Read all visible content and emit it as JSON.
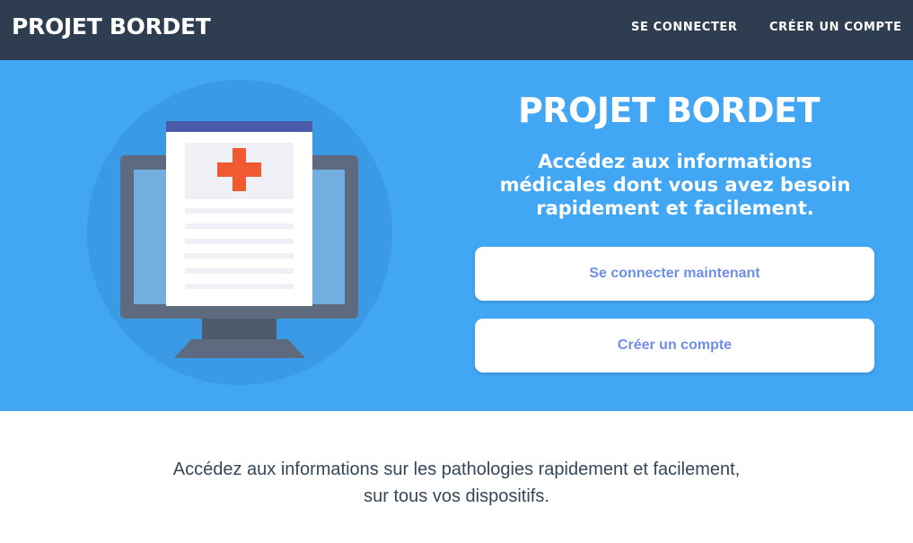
{
  "navbar": {
    "brand": "PROJET BORDET",
    "links": {
      "login": "SE CONNECTER",
      "signup": "CRÉER UN COMPTE"
    }
  },
  "hero": {
    "title": "PROJET BORDET",
    "subtitle_lines": [
      "Accédez aux informations",
      "médicales dont vous avez besoin",
      "rapidement et facilement."
    ],
    "buttons": {
      "login": "Se connecter maintenant",
      "signup": "Créer un compte"
    },
    "illustration_icon": "computer-medical-document-icon"
  },
  "intro": {
    "lines": [
      "Accédez aux informations sur les pathologies rapidement et facilement,",
      "sur tous vos dispositifs."
    ]
  },
  "colors": {
    "navbar_bg": "#2e3e50",
    "hero_bg": "#41a6f4",
    "button_text": "#6f8ee6",
    "medical_cross": "#f05a30",
    "document_header": "#4a5aa8",
    "body_text": "#34475a"
  }
}
